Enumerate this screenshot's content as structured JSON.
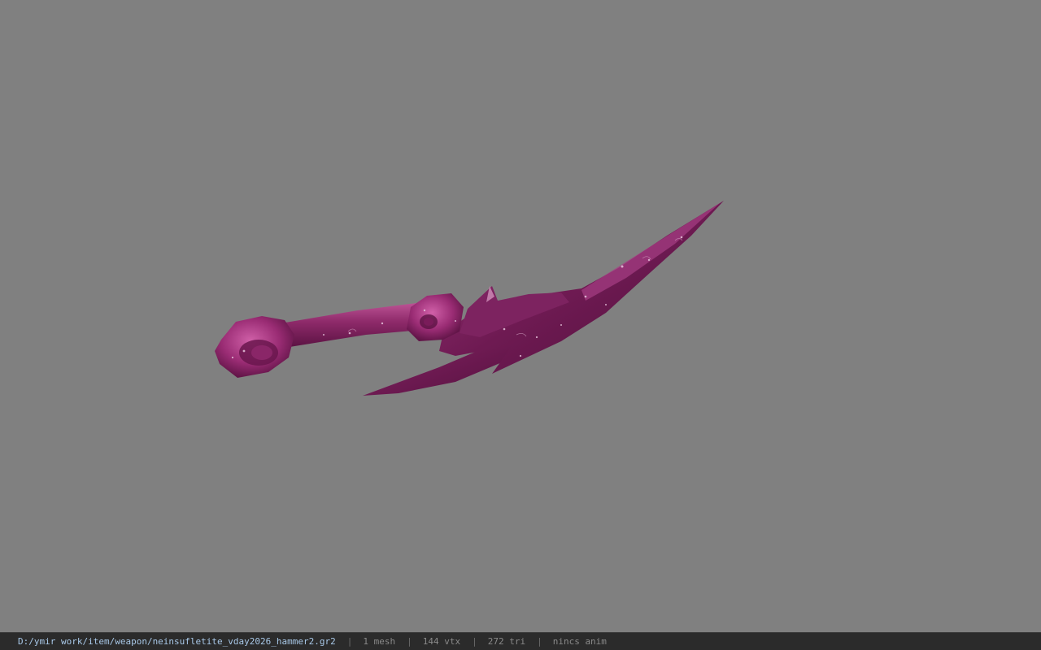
{
  "viewport": {
    "background": "#808080",
    "model_color": "#7a1f5a",
    "model_highlight": "#b84a8c",
    "model_shadow": "#4a0f36"
  },
  "statusbar": {
    "path": "D:/ymir work/item/weapon/neinsufletite_vday2026_hammer2.gr2",
    "mesh_count": "1 mesh",
    "vertex_count": "144 vtx",
    "triangle_count": "272 tri",
    "anim_status": "nincs anim",
    "separator": "|"
  }
}
